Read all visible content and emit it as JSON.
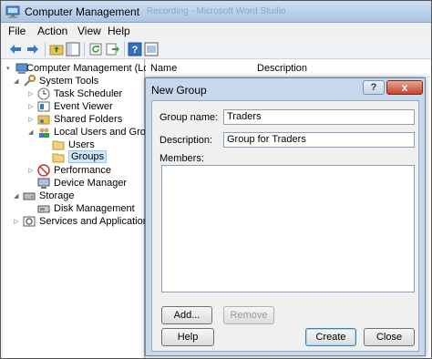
{
  "window": {
    "title": "Computer Management",
    "title_bg_text": "Recording - Microsoft Word Studio"
  },
  "menu": [
    "File",
    "Action",
    "View",
    "Help"
  ],
  "toolbar": {
    "icons": [
      "back-arrow-icon",
      "forward-arrow-icon",
      "up-folder-icon",
      "show-hide-tree-icon",
      "refresh-icon",
      "export-list-icon",
      "help-icon",
      "properties-icon"
    ]
  },
  "tree": {
    "items": [
      {
        "label": "Computer Management (Local",
        "icon": "computer-icon",
        "expander": "▾"
      },
      {
        "label": "System Tools",
        "icon": "tools-icon",
        "expander": "◢"
      },
      {
        "label": "Task Scheduler",
        "icon": "clock-icon",
        "expander": "▷"
      },
      {
        "label": "Event Viewer",
        "icon": "event-viewer-icon",
        "expander": "▷"
      },
      {
        "label": "Shared Folders",
        "icon": "shared-folder-icon",
        "expander": "▷"
      },
      {
        "label": "Local Users and Groups",
        "icon": "users-icon",
        "expander": "◢"
      },
      {
        "label": "Users",
        "icon": "folder-icon",
        "expander": ""
      },
      {
        "label": "Groups",
        "icon": "folder-icon",
        "expander": ""
      },
      {
        "label": "Performance",
        "icon": "performance-icon",
        "expander": "▷"
      },
      {
        "label": "Device Manager",
        "icon": "device-manager-icon",
        "expander": ""
      },
      {
        "label": "Storage",
        "icon": "storage-icon",
        "expander": "◢"
      },
      {
        "label": "Disk Management",
        "icon": "disk-icon",
        "expander": ""
      },
      {
        "label": "Services and Applications",
        "icon": "services-icon",
        "expander": "▷"
      }
    ]
  },
  "list": {
    "columns": [
      "Name",
      "Description"
    ]
  },
  "dialog": {
    "title": "New Group",
    "help_glyph": "?",
    "close_glyph": "x",
    "group_name_label": "Group name:",
    "group_name_value": "Traders",
    "description_label": "Description:",
    "description_value": "Group for Traders",
    "members_label": "Members:",
    "add_label": "Add...",
    "remove_label": "Remove",
    "help_label": "Help",
    "create_label": "Create",
    "close_label": "Close"
  },
  "colors": {
    "accent": "#3c7fb1",
    "selection": "#cde8ff",
    "dialog_frame": "#c8d8ec",
    "close_button": "#c4452f"
  }
}
